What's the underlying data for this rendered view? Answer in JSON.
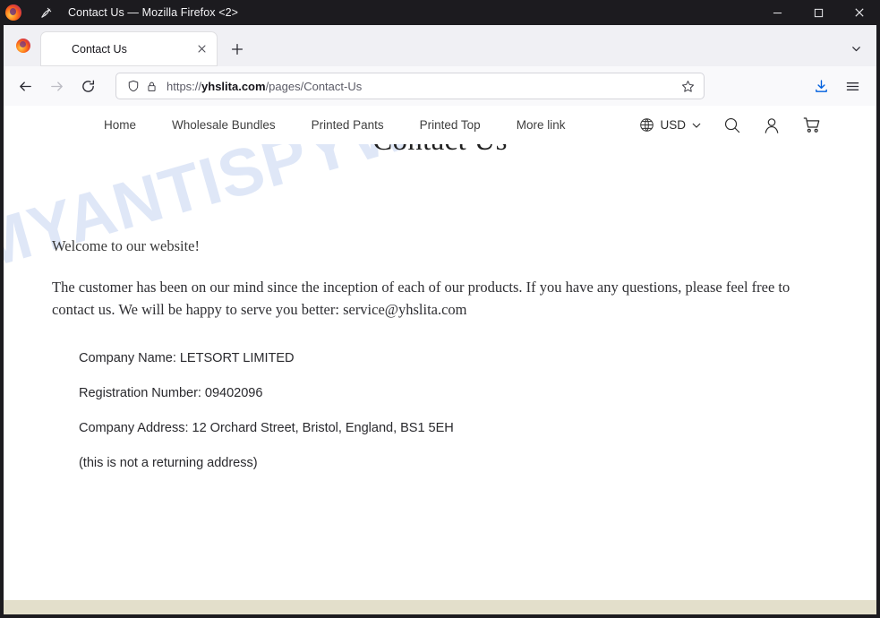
{
  "window": {
    "title": "Contact Us — Mozilla Firefox <2>",
    "icons": {
      "app": "firefox-logo-icon",
      "pin": "pin-icon",
      "minimize": "minimize-icon",
      "maximize": "maximize-icon",
      "close": "close-icon"
    }
  },
  "tabbar": {
    "tabs": [
      {
        "title": "Contact Us",
        "favicon": "firefox-favicon-icon",
        "close": "tab-close-icon"
      }
    ],
    "new_tab_label": "+",
    "list_all_tabs": "chevron-down-icon"
  },
  "toolbar": {
    "back": "back-arrow-icon",
    "forward": "forward-arrow-icon",
    "reload": "reload-icon",
    "shield": "shield-icon",
    "lock": "lock-icon",
    "bookmark": "star-icon",
    "downloads": "download-icon",
    "menu": "hamburger-menu-icon",
    "url": {
      "scheme": "https://",
      "host": "yhslita.com",
      "path": "/pages/Contact-Us",
      "full": "https://yhslita.com/pages/Contact-Us"
    }
  },
  "site": {
    "nav_links": [
      "Home",
      "Wholesale Bundles",
      "Printed Pants",
      "Printed Top",
      "More link"
    ],
    "currency": {
      "globe_icon": "globe-icon",
      "value": "USD",
      "chevron": "chevron-down-icon"
    },
    "actions": {
      "search": "search-icon",
      "account": "user-account-icon",
      "cart": "shopping-cart-icon"
    }
  },
  "page": {
    "heading": "Contact Us",
    "welcome": "Welcome to our website!",
    "paragraph": "The customer has been on our mind since the inception of each of our products. If you have any questions, please feel free to contact us. We will be happy to serve you better: service@yhslita.com",
    "details": [
      "Company Name: LETSORT LIMITED",
      "Registration Number: 09402096",
      "Company Address: 12 Orchard Street, Bristol, England, BS1 5EH",
      "(this is not a returning address)"
    ],
    "watermark": "MYANTISPYWARE.COM"
  },
  "colors": {
    "titlebar_bg": "#1c1b1f",
    "tabstrip_bg": "#f0f0f4",
    "toolbar_bg": "#f9f9fb",
    "page_bg": "#ffffff",
    "watermark": "#dfe7f7",
    "download_accent": "#0060df",
    "bottom_strip": "#e3dfcb"
  }
}
